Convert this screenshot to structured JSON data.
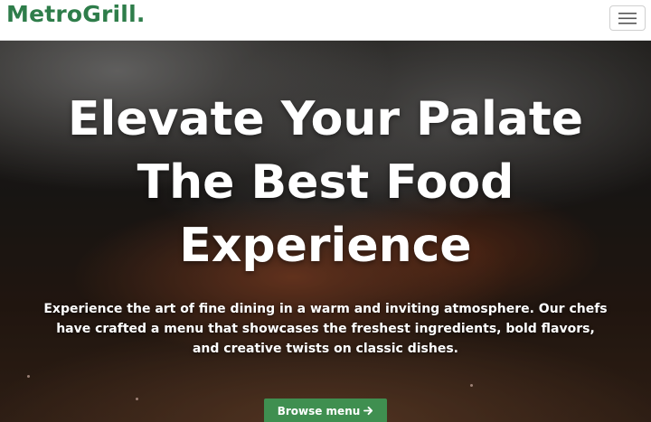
{
  "navbar": {
    "brand": "MetroGrill.",
    "toggler_icon": "hamburger-menu-icon"
  },
  "hero": {
    "headline_lines": [
      "Elevate Your Palate",
      "The Best Food",
      "Experience"
    ],
    "lead_lines": [
      "Experience the art of fine dining in a warm and inviting atmosphere. Our chefs",
      "have crafted a menu that showcases the freshest ingredients, bold flavors,",
      "and creative twists on classic dishes."
    ],
    "cta_label": "Browse menu",
    "cta_icon": "arrow-right-icon"
  },
  "colors": {
    "brand": "#2e7d4a",
    "button": "#3f8f50"
  }
}
